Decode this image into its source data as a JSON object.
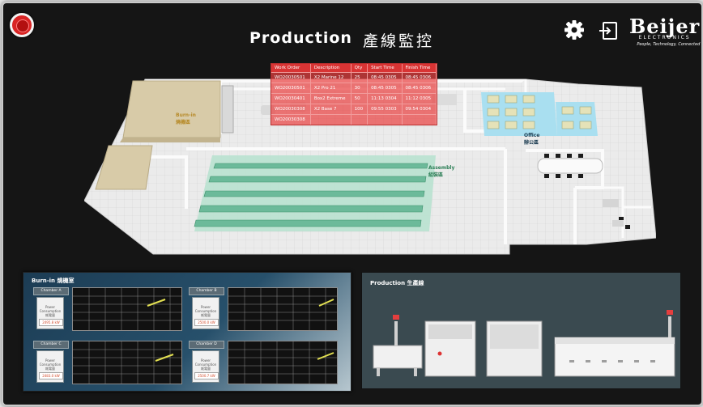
{
  "header": {
    "title": "Production",
    "title_zh": "產線監控"
  },
  "brand": {
    "name": "Beijer",
    "sub": "ELECTRONICS",
    "tagline": "People, Technology, Connected"
  },
  "colors": {
    "table_header": "#d93434",
    "table_body": "rgba(233,67,67,0.72)",
    "assembly_zone": "#74c6a3",
    "office_zone": "#a9dff0",
    "burnin_zone": "#d8cba8"
  },
  "zones": {
    "burnin": {
      "en": "Burn-in",
      "zh": "燒機區"
    },
    "assembly": {
      "en": "Assembly",
      "zh": "組裝區"
    },
    "office": {
      "en": "Office",
      "zh": "辦公區"
    }
  },
  "work_orders": {
    "headers": [
      "Work Order",
      "Description",
      "Qty",
      "Start Time",
      "Finish Time"
    ],
    "rows": [
      [
        "WO20030501",
        "X2 Marine 12",
        "25",
        "08:45 0305",
        "08:45 0306"
      ],
      [
        "WO20030501",
        "X2 Pro 21",
        "30",
        "08:45 0305",
        "08:45 0306"
      ],
      [
        "WO20030401",
        "Box2 Extreme",
        "50",
        "11:13 0304",
        "11:12 0305"
      ],
      [
        "WO20030308",
        "X2 Base 7",
        "100",
        "09:55 0303",
        "09:54 0304"
      ],
      [
        "WO20030308",
        "",
        "",
        "",
        ""
      ]
    ]
  },
  "burnin_panel": {
    "title": "Burn-in 燒機室",
    "cards": [
      {
        "chamber": "Chamber A",
        "metric_en": "Power Consumption",
        "metric_zh": "耗電量",
        "value": "2495.8 kW"
      },
      {
        "chamber": "Chamber B",
        "metric_en": "Power Consumption",
        "metric_zh": "耗電量",
        "value": "2500.0 kW"
      },
      {
        "chamber": "Chamber C",
        "metric_en": "Power Consumption",
        "metric_zh": "耗電量",
        "value": "2483.0 kW"
      },
      {
        "chamber": "Chamber D",
        "metric_en": "Power Consumption",
        "metric_zh": "耗電量",
        "value": "2500.7 kW"
      }
    ]
  },
  "production_panel": {
    "title": "Production 生產線"
  }
}
